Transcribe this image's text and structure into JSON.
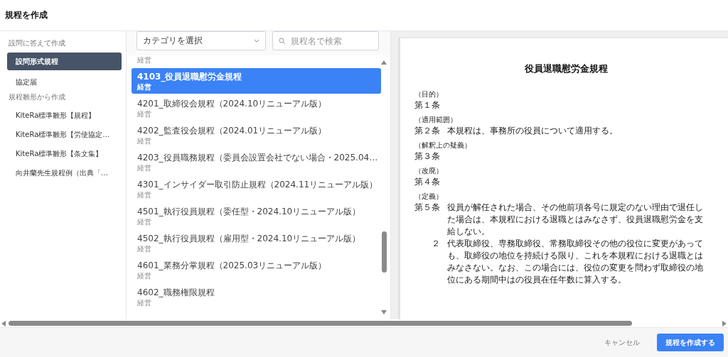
{
  "window": {
    "title": "規程を作成"
  },
  "sidebar": {
    "sections": [
      {
        "label": "設問に答えて作成",
        "items": [
          {
            "label": "設問形式規程",
            "selected": true
          },
          {
            "label": "協定届",
            "selected": false
          }
        ]
      },
      {
        "label": "規程雛形から作成",
        "items": [
          {
            "label": "KiteRa標準雛形【規程】",
            "selected": false
          },
          {
            "label": "KiteRa標準雛形【労使協定…",
            "selected": false
          },
          {
            "label": "KiteRa標準雛形【条文集】",
            "selected": false
          },
          {
            "label": "向井蘭先生規程例（出典「…",
            "selected": false
          }
        ]
      }
    ]
  },
  "filters": {
    "category": {
      "value": "カテゴリを選択"
    },
    "search": {
      "placeholder": "規程名で検索"
    }
  },
  "templates": [
    {
      "category": "経営",
      "selected": false
    },
    {
      "title": "4103_役員退職慰労金規程",
      "category": "経営",
      "selected": true
    },
    {
      "title": "4201_取締役会規程（2024.10リニューアル版）",
      "category": "経営",
      "selected": false
    },
    {
      "title": "4202_監査役会規程（2024.01リニューアル版）",
      "category": "経営",
      "selected": false
    },
    {
      "title": "4203_役員職務規程（委員会設置会社でない場合・2025.04…",
      "category": "経営",
      "selected": false
    },
    {
      "title": "4301_インサイダー取引防止規程（2024.11リニューアル版）",
      "category": "経営",
      "selected": false
    },
    {
      "title": "4501_執行役員規程（委任型・2024.10リニューアル版）",
      "category": "経営",
      "selected": false
    },
    {
      "title": "4502_執行役員規程（雇用型・2024.10リニューアル版）",
      "category": "経営",
      "selected": false
    },
    {
      "title": "4601_業務分掌規程（2025.03リニューアル版）",
      "category": "経営",
      "selected": false
    },
    {
      "title": "4602_職務権限規程",
      "category": "経営",
      "selected": false
    }
  ],
  "preview": {
    "title": "役員退職慰労金規程",
    "articles": [
      {
        "heading": "（目的）",
        "number": "第１条"
      },
      {
        "heading": "（適用範囲）",
        "number": "第２条",
        "text": "本規程は、事務所の役員について適用する。"
      },
      {
        "heading": "（解釈上の疑義）",
        "number": "第３条"
      },
      {
        "heading": "（改廃）",
        "number": "第４条"
      },
      {
        "heading": "（定義）",
        "number": "第５条",
        "text": "役員が解任された場合、その他前項各号に規定のない理由で退任した場合は、本規程における退職とはみなさず、役員退職慰労金を支給しない。",
        "paragraphs": [
          {
            "number": "２",
            "text": "代表取締役、専務取締役、常務取締役その他の役位に変更があっても、取締役の地位を持続ける限り、これを本規程における退職とはみなさない。なお、この場合には、役位の変更を問わず取締役の地位にある期間中はの役員在任年数に算入する。"
          }
        ]
      }
    ]
  },
  "footer": {
    "buttons": [
      {
        "label": "キャンセル",
        "kind": "secondary"
      },
      {
        "label": "規程を作成する",
        "kind": "primary"
      }
    ]
  }
}
